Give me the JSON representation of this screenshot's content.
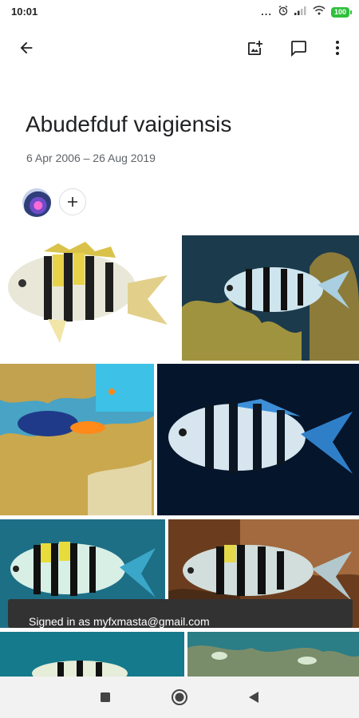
{
  "status_bar": {
    "time": "10:01",
    "more_indicator": "...",
    "battery": "100"
  },
  "app_bar": {
    "back_icon": "arrow-back-icon",
    "add_photo_icon": "add-photo-icon",
    "comment_icon": "comment-icon",
    "more_icon": "more-vert-icon"
  },
  "album": {
    "title": "Abudefduf vaigiensis",
    "date_range": "6 Apr 2006 – 26 Aug 2019"
  },
  "people": {
    "avatar_icon": "user-avatar",
    "add_person_icon": "add-icon"
  },
  "photos": [
    {
      "subject": "fish-white-background"
    },
    {
      "subject": "fish-over-coral"
    },
    {
      "subject": "reef-scene"
    },
    {
      "subject": "fish-dark-background"
    },
    {
      "subject": "fish-blue-water"
    },
    {
      "subject": "fish-near-rocks"
    },
    {
      "subject": "fish-partial-left"
    },
    {
      "subject": "reef-partial-right"
    }
  ],
  "snackbar": {
    "text": "Signed in as myfxmasta@gmail.com"
  },
  "nav_bar": {
    "recents_icon": "square-icon",
    "home_icon": "circle-icon",
    "back_icon": "triangle-back-icon"
  },
  "colors": {
    "accent_battery": "#2fbf3c",
    "snackbar_bg": "#323232",
    "nav_bg": "#f2f2f2"
  }
}
